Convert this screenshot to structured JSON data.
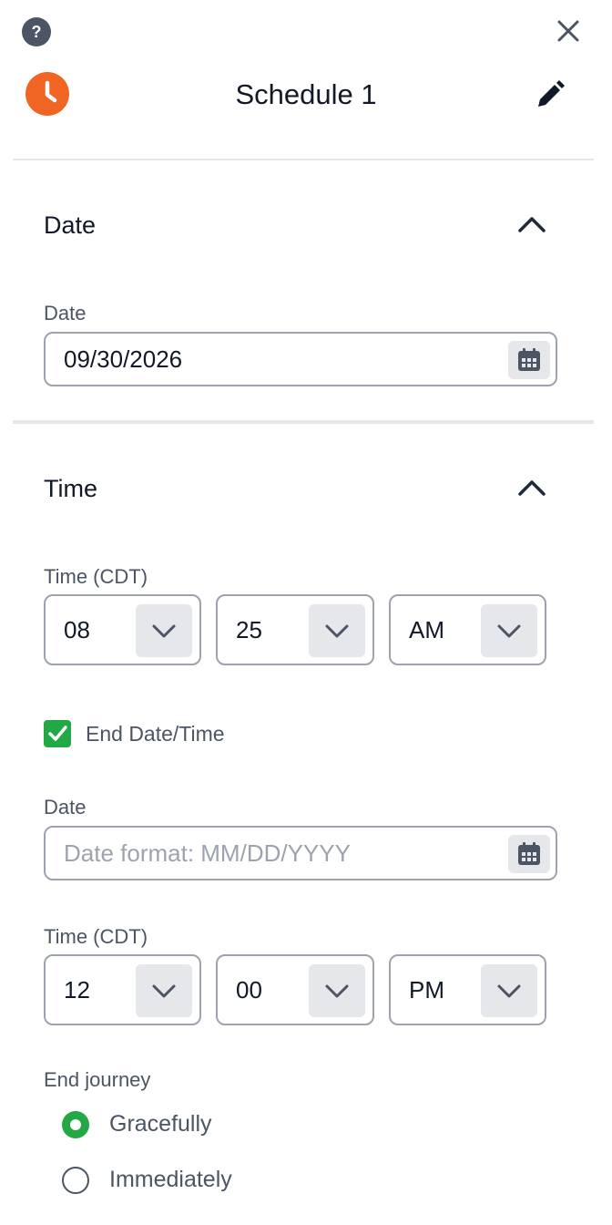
{
  "header": {
    "help_symbol": "?",
    "title": "Schedule 1"
  },
  "date_section": {
    "title": "Date",
    "date_label": "Date",
    "date_value": "09/30/2026"
  },
  "time_section": {
    "title": "Time",
    "time_label": "Time (CDT)",
    "start_time": {
      "hour": "08",
      "minute": "25",
      "meridiem": "AM"
    },
    "end_toggle": {
      "label": "End Date/Time",
      "checked": true
    },
    "end_date_label": "Date",
    "end_date_placeholder": "Date format: MM/DD/YYYY",
    "end_time_label": "Time (CDT)",
    "end_time": {
      "hour": "12",
      "minute": "00",
      "meridiem": "PM"
    },
    "end_journey": {
      "label": "End journey",
      "options": [
        {
          "label": "Gracefully",
          "selected": true
        },
        {
          "label": "Immediately",
          "selected": false
        }
      ]
    }
  },
  "colors": {
    "accent_orange": "#f06424",
    "success_green": "#22a945",
    "border_gray": "#9ca3af"
  }
}
